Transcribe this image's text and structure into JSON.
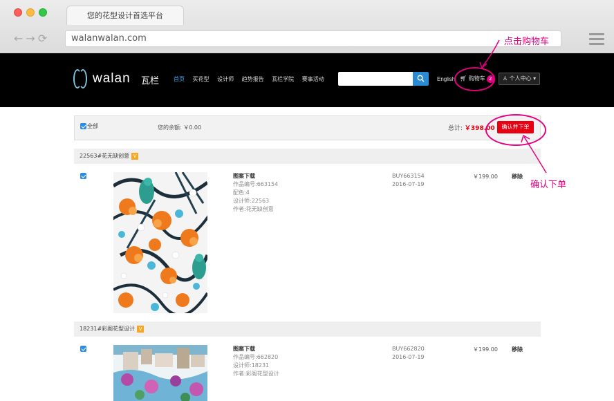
{
  "browser": {
    "tab_title": "您的花型设计首选平台",
    "url": "walanwalan.com"
  },
  "header": {
    "logo_word": "walan",
    "logo_cn": "瓦栏",
    "nav": [
      {
        "label": "首页",
        "active": true
      },
      {
        "label": "买花型",
        "active": false
      },
      {
        "label": "设计师",
        "active": false
      },
      {
        "label": "趋势报告",
        "active": false
      },
      {
        "label": "瓦栏学院",
        "active": false
      },
      {
        "label": "赛事活动",
        "active": false
      }
    ],
    "lang": "English",
    "cart_label": "购物车",
    "cart_count": "2",
    "user_label": "个人中心"
  },
  "summary": {
    "select_all": "全部",
    "balance": "您的余额: ￥0.00",
    "total_label": "总计:",
    "total_value": "￥398.00",
    "confirm_label": "确认并下单"
  },
  "items": [
    {
      "shop": "22563#花无缺创意",
      "badge": "V",
      "title": "图案下载",
      "code": "作品编号:663154",
      "colors": "配色:4",
      "designer": "设计师:22563",
      "author": "作者:花无缺创意",
      "order_no": "BUY663154",
      "date": "2016-07-19",
      "price": "￥199.00",
      "remove": "移除"
    },
    {
      "shop": "18231#彩阁花型设计",
      "badge": "V",
      "title": "图案下载",
      "code": "作品编号:662820",
      "designer": "设计师:18231",
      "author": "作者:彩阁花型设计",
      "order_no": "BUY662820",
      "date": "2016-07-19",
      "price": "￥199.00",
      "remove": "移除"
    }
  ],
  "annotations": {
    "cart_hint": "点击购物车",
    "confirm_hint": "确认下单",
    "color": "#e4007f"
  }
}
